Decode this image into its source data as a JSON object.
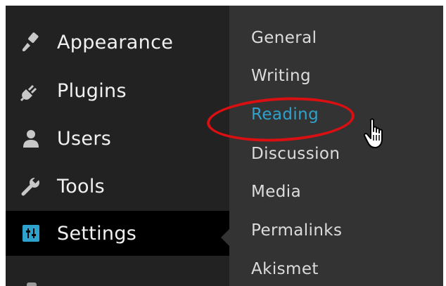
{
  "admin_menu": {
    "items": [
      {
        "label": "Appearance",
        "icon": "paintbrush-icon"
      },
      {
        "label": "Plugins",
        "icon": "plug-icon"
      },
      {
        "label": "Users",
        "icon": "user-icon"
      },
      {
        "label": "Tools",
        "icon": "wrench-icon"
      },
      {
        "label": "Settings",
        "icon": "sliders-icon",
        "active": true
      }
    ]
  },
  "settings_submenu": {
    "items": [
      {
        "label": "General"
      },
      {
        "label": "Writing"
      },
      {
        "label": "Reading",
        "current": true
      },
      {
        "label": "Discussion"
      },
      {
        "label": "Media"
      },
      {
        "label": "Permalinks"
      },
      {
        "label": "Akismet"
      }
    ]
  },
  "colors": {
    "menu_bg": "#222222",
    "submenu_bg": "#333333",
    "active_bg": "#000000",
    "accent": "#2ea2cc",
    "highlight_circle": "#d90f12",
    "text": "#f1f1f1"
  }
}
